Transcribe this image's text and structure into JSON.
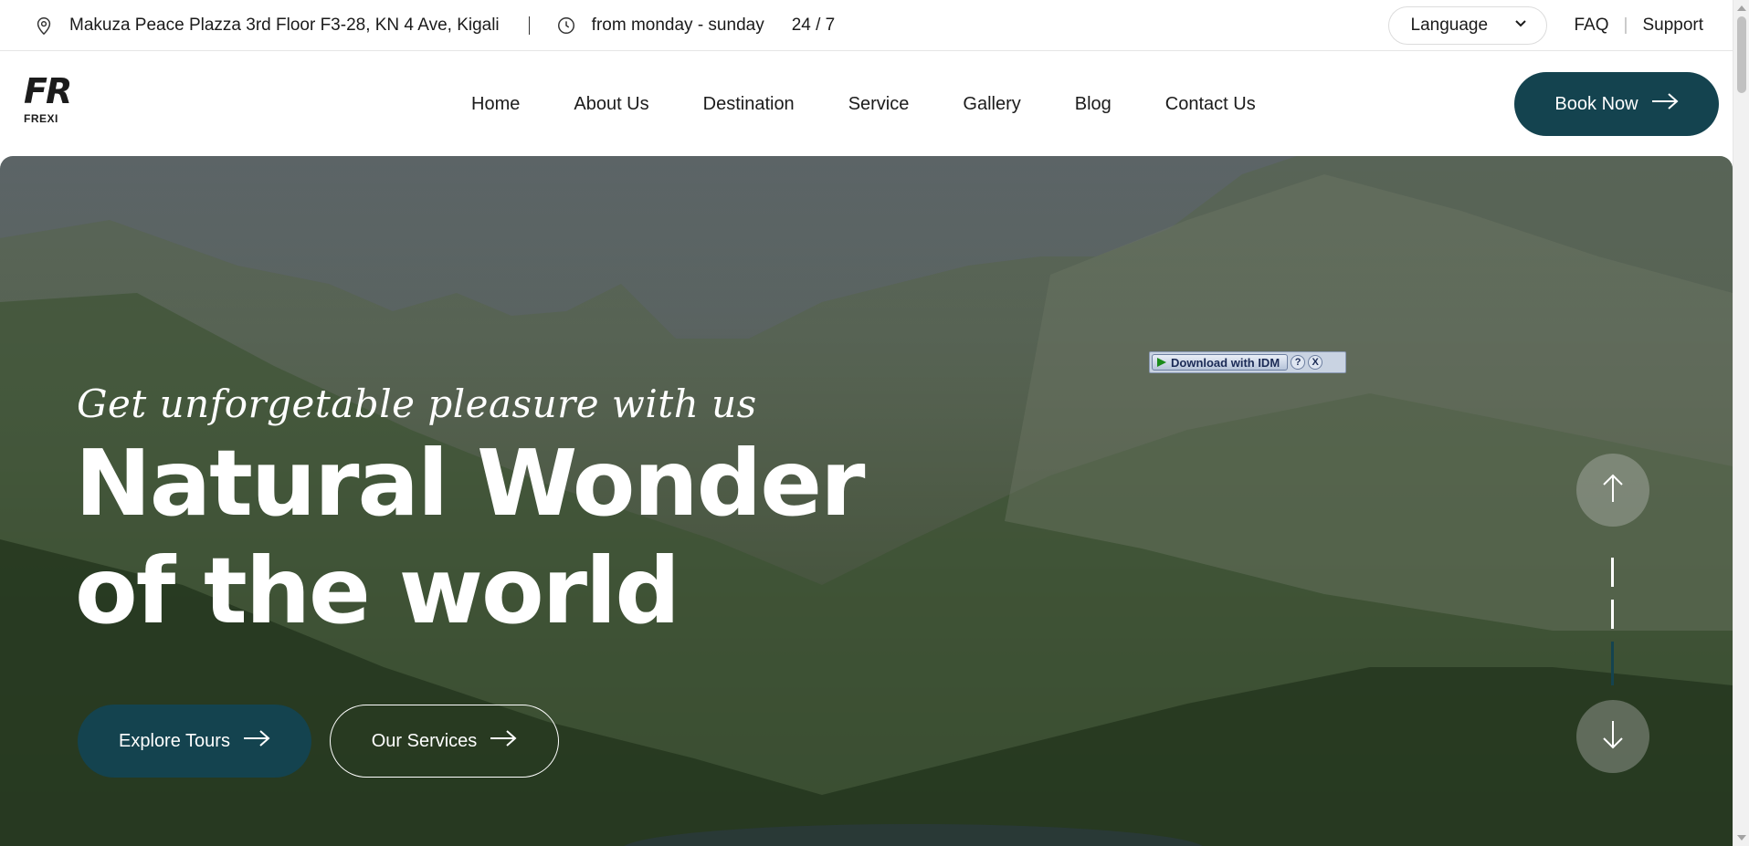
{
  "topbar": {
    "address": "Makuza Peace Plazza 3rd Floor F3-28, KN 4 Ave, Kigali",
    "hours": "from monday - sunday",
    "availability": "24 / 7",
    "language_label": "Language",
    "faq_label": "FAQ",
    "separator": "|",
    "support_label": "Support"
  },
  "header": {
    "logo_mark": "FR",
    "logo_text": "FREXI",
    "nav": [
      "Home",
      "About Us",
      "Destination",
      "Service",
      "Gallery",
      "Blog",
      "Contact Us"
    ],
    "book_label": "Book Now"
  },
  "hero": {
    "tagline": "Get unforgetable pleasure with us",
    "title_line1": "Natural Wonder",
    "title_line2": "of the world",
    "explore_label": "Explore Tours",
    "services_label": "Our Services",
    "slide_progress": 0.3
  },
  "idm_overlay": {
    "download_label": "Download with IDM",
    "help_label": "?",
    "close_label": "X"
  },
  "colors": {
    "accent": "#14434f",
    "text": "#1b1b1b",
    "hero_text": "#ffffff"
  },
  "icons": {
    "location": "location-pin-icon",
    "clock": "clock-icon",
    "chevron": "chevron-down-icon",
    "arrow": "arrow-right-icon",
    "up": "arrow-up-icon",
    "down": "arrow-down-icon",
    "play": "play-icon"
  }
}
